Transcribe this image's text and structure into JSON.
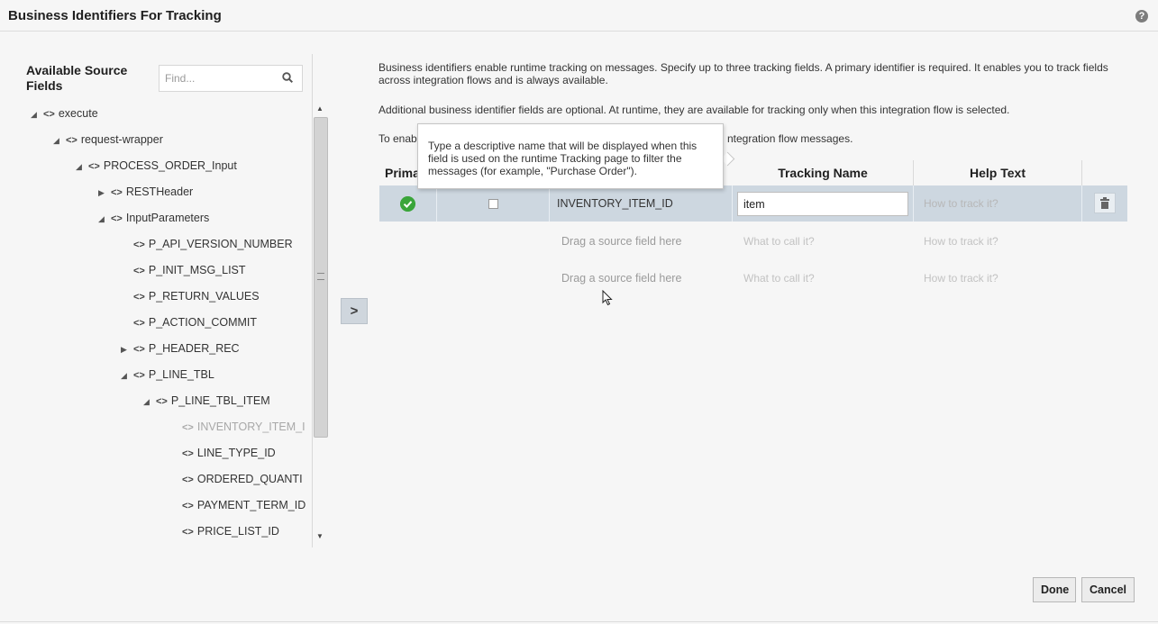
{
  "header": {
    "title": "Business Identifiers For Tracking",
    "help_icon": "question-circle-icon"
  },
  "source_panel": {
    "title": "Available Source Fields",
    "search_placeholder": "Find...",
    "tree": [
      {
        "label": "execute",
        "toggle": "◢",
        "tag": "<>"
      },
      {
        "label": "request-wrapper",
        "toggle": "◢",
        "tag": "<>"
      },
      {
        "label": "PROCESS_ORDER_Input",
        "toggle": "◢",
        "tag": "<>"
      },
      {
        "label": "RESTHeader",
        "toggle": "▶",
        "tag": "<>"
      },
      {
        "label": "InputParameters",
        "toggle": "◢",
        "tag": "<>"
      },
      {
        "label": "P_API_VERSION_NUMBER",
        "toggle": "",
        "tag": "<>"
      },
      {
        "label": "P_INIT_MSG_LIST",
        "toggle": "",
        "tag": "<>"
      },
      {
        "label": "P_RETURN_VALUES",
        "toggle": "",
        "tag": "<>"
      },
      {
        "label": "P_ACTION_COMMIT",
        "toggle": "",
        "tag": "<>"
      },
      {
        "label": "P_HEADER_REC",
        "toggle": "▶",
        "tag": "<>"
      },
      {
        "label": "P_LINE_TBL",
        "toggle": "◢",
        "tag": "<>"
      },
      {
        "label": "P_LINE_TBL_ITEM",
        "toggle": "◢",
        "tag": "<>"
      },
      {
        "label": "INVENTORY_ITEM_I",
        "toggle": "",
        "tag": "<>"
      },
      {
        "label": "LINE_TYPE_ID",
        "toggle": "",
        "tag": "<>"
      },
      {
        "label": "ORDERED_QUANTI",
        "toggle": "",
        "tag": "<>"
      },
      {
        "label": "PAYMENT_TERM_ID",
        "toggle": "",
        "tag": "<>"
      },
      {
        "label": "PRICE_LIST_ID",
        "toggle": "",
        "tag": "<>"
      }
    ]
  },
  "description": {
    "para1": "Business identifiers enable runtime tracking on messages. Specify up to three tracking fields. A primary identifier is required. It enables you to track fields across integration flows and is always available.",
    "para2": "Additional business identifier fields are optional. At runtime, they are available for tracking only when this integration flow is selected.",
    "para3_start": "To enab",
    "para3_end": "ntegration flow messages."
  },
  "tooltip": "Type a descriptive name that will be displayed when this field is used on the runtime Tracking page to filter the messages (for example, \"Purchase Order\").",
  "grid": {
    "headers": {
      "primary": "Prima",
      "tracking_name": "Tracking Name",
      "help_text": "Help Text"
    },
    "row": {
      "field": "INVENTORY_ITEM_ID",
      "tracking_name": "item",
      "help_placeholder": "How to track it?",
      "primary_selected": true,
      "checkbox_checked": false
    },
    "empty_rows": [
      {
        "drop": "Drag a source field here",
        "name_placeholder": "What to call it?",
        "help_placeholder": "How to track it?"
      },
      {
        "drop": "Drag a source field here",
        "name_placeholder": "What to call it?",
        "help_placeholder": "How to track it?"
      }
    ]
  },
  "buttons": {
    "done": "Done",
    "cancel": "Cancel"
  },
  "colors": {
    "selected_row": "#cdd7e0",
    "primary_check": "#2e9f2e"
  }
}
